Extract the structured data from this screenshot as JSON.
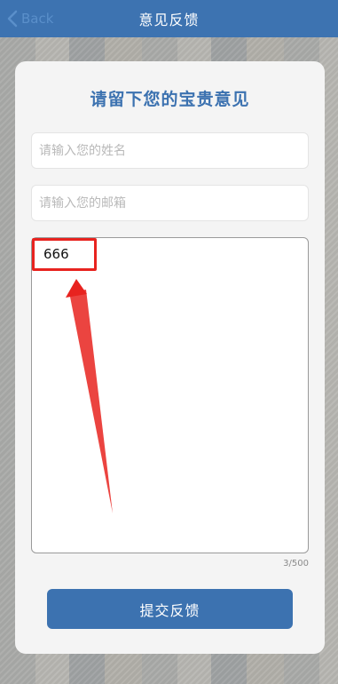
{
  "nav": {
    "back_label": "Back",
    "title": "意见反馈"
  },
  "form": {
    "heading": "请留下您的宝贵意见",
    "name_placeholder": "请输入您的姓名",
    "email_placeholder": "请输入您的邮箱",
    "message_value": "666",
    "counter": "3/500",
    "submit_label": "提交反馈"
  },
  "colors": {
    "nav_bar": "#3d73b1",
    "accent": "#3c72b0",
    "annotation": "#e8231f"
  }
}
